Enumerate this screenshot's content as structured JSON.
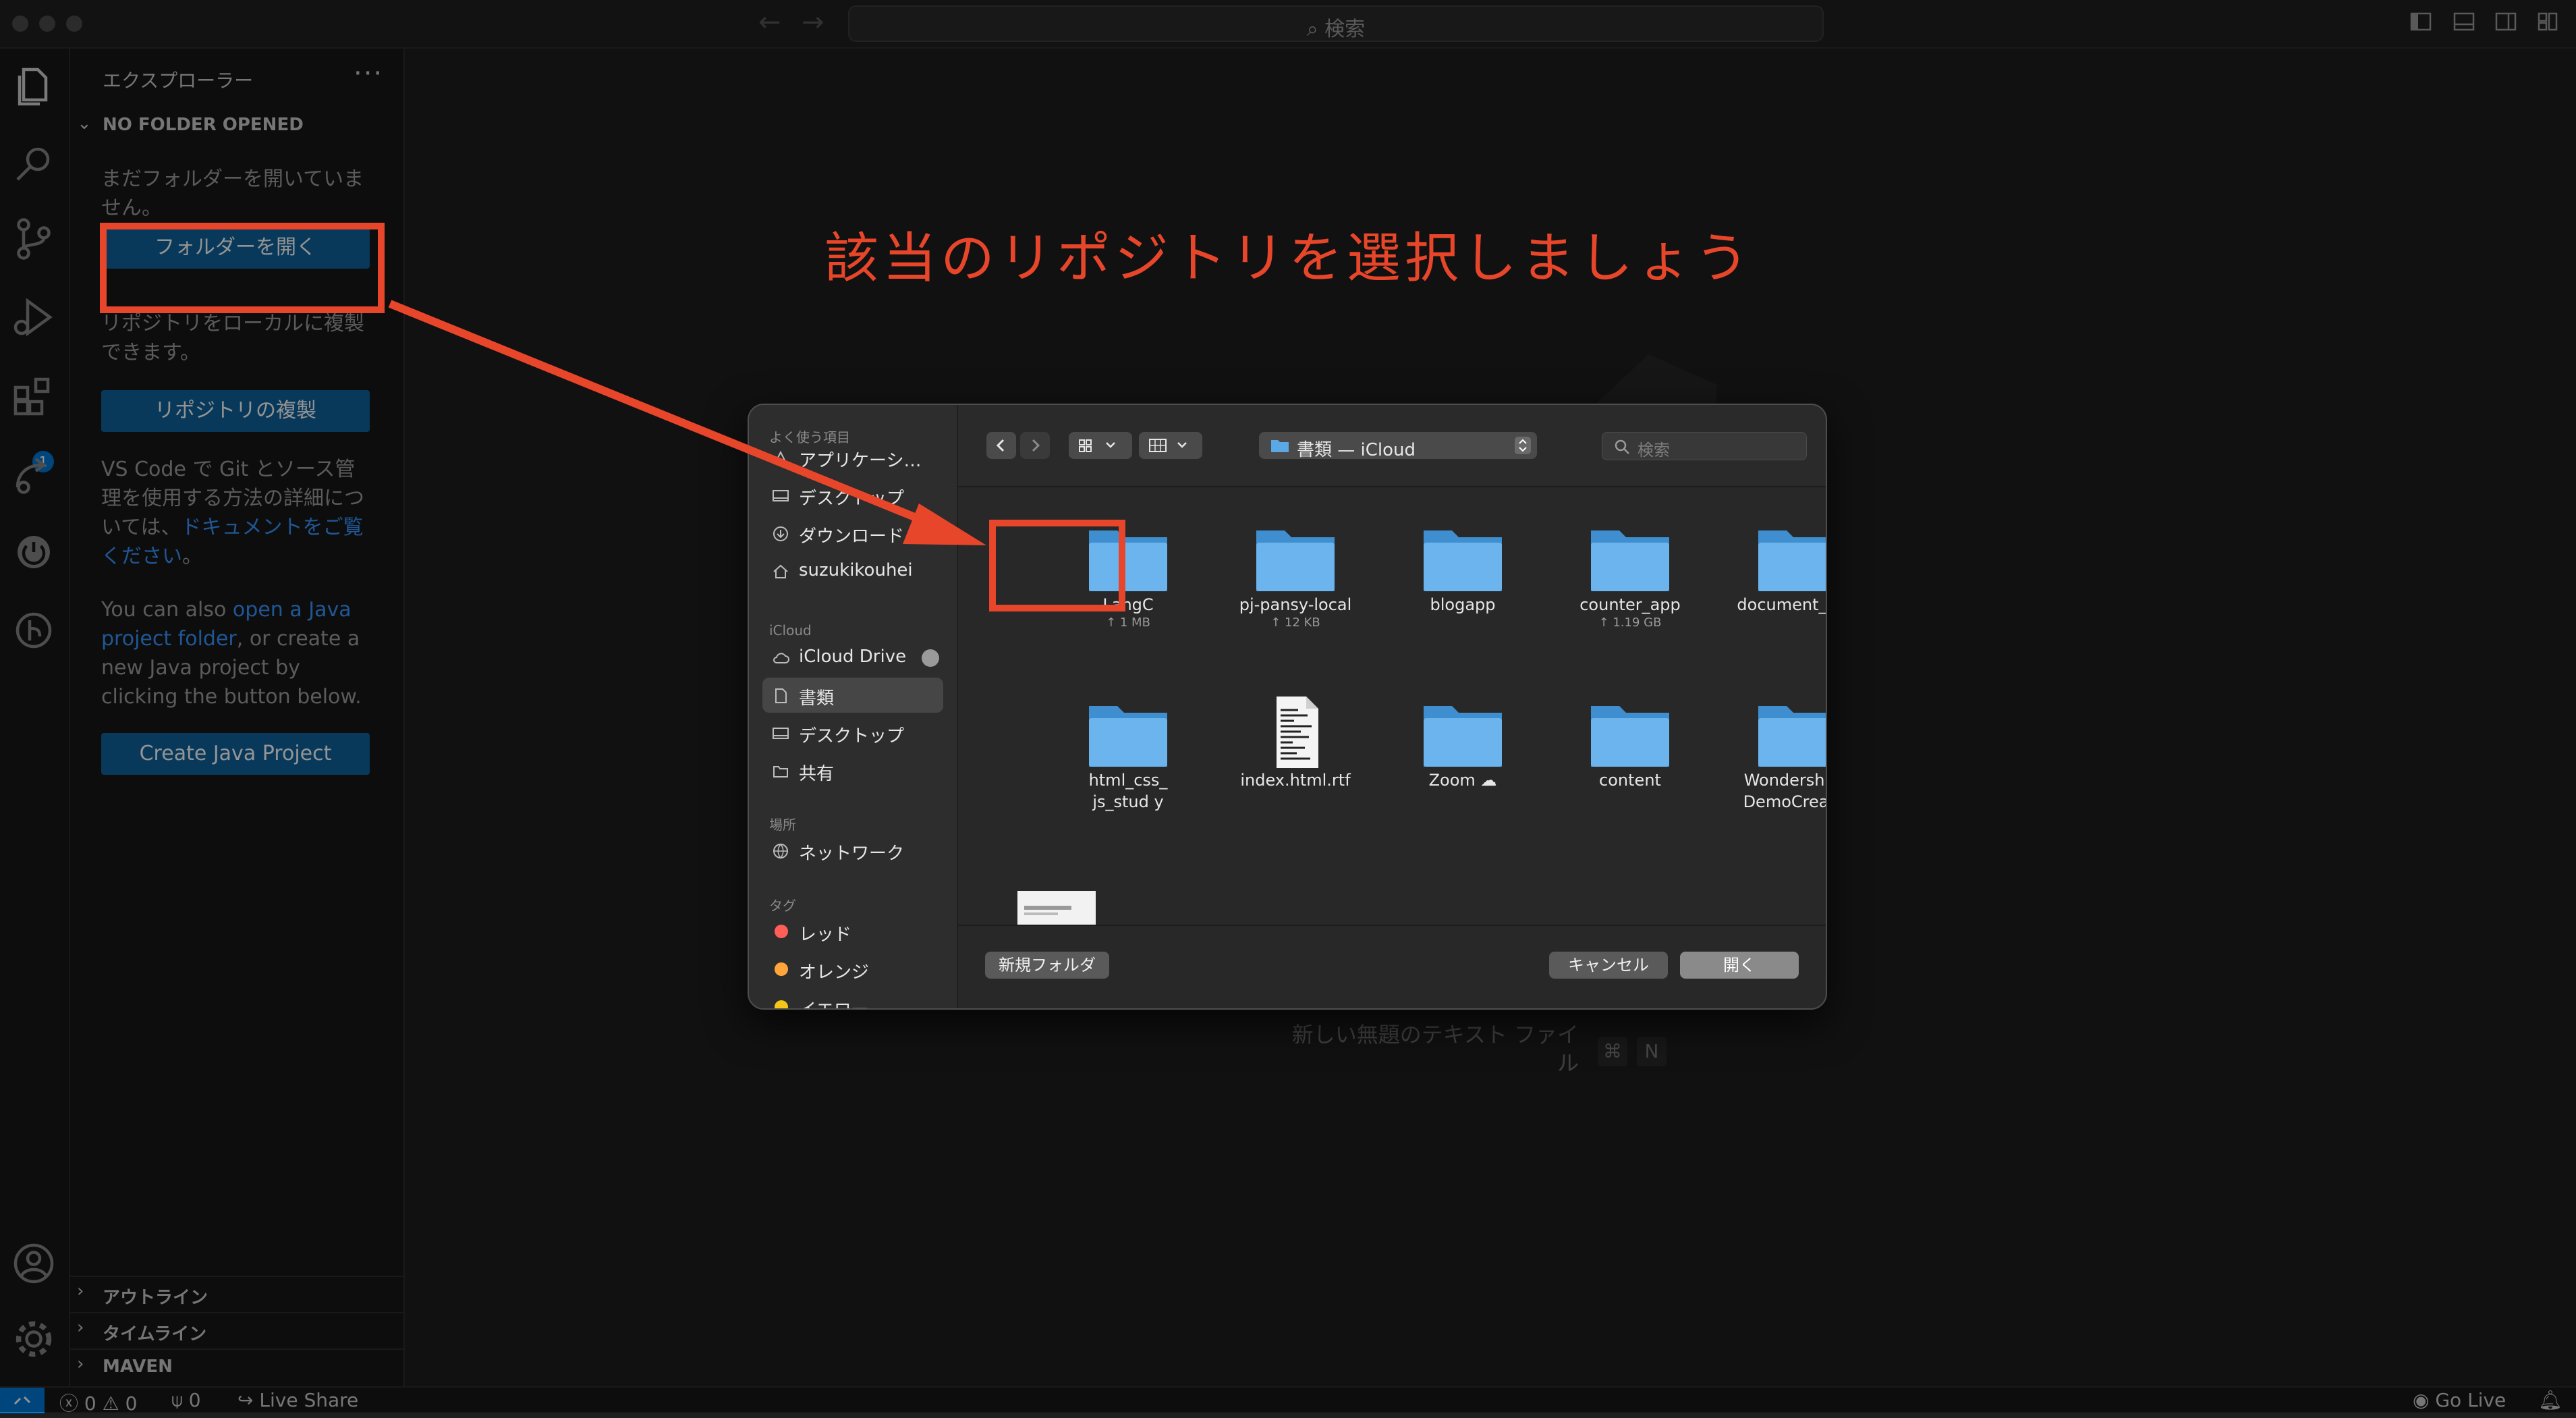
{
  "titlebar": {
    "search_label": "検索"
  },
  "sidebar": {
    "title": "エクスプローラー",
    "section_title": "NO FOLDER OPENED",
    "no_folder_text": "まだフォルダーを開いていません。",
    "open_folder_button": "フォルダーを開く",
    "clone_text": "リポジトリをローカルに複製できます。",
    "clone_button": "リポジトリの複製",
    "git_text_1": "VS Code で Git とソース管理を使用する方法の詳細については、",
    "git_link": "ドキュメントをご覧ください",
    "git_text_2": "。",
    "java_text_1": "You can also ",
    "java_link": "open a Java project folder",
    "java_text_2": ", or create a new Java project by clicking the button below.",
    "java_button": "Create Java Project",
    "bottom_sections": [
      "アウトライン",
      "タイムライン",
      "MAVEN"
    ],
    "badge_count": "1"
  },
  "annotation": {
    "text": "該当のリポジトリを選択しましょう",
    "color": "#e8462a"
  },
  "editor_hint": {
    "text": "新しい無題のテキスト ファイル",
    "keys": [
      "⌘",
      "N"
    ]
  },
  "dialog": {
    "sidebar": {
      "favorites_label": "よく使う項目",
      "favorites": [
        {
          "label": "アプリケーシ…",
          "icon": "applications-icon"
        },
        {
          "label": "デスクトップ",
          "icon": "desktop-icon"
        },
        {
          "label": "ダウンロード",
          "icon": "download-icon"
        },
        {
          "label": "suzukikouhei",
          "icon": "home-icon"
        }
      ],
      "icloud_label": "iCloud",
      "icloud": [
        {
          "label": "iCloud Drive",
          "icon": "cloud-icon"
        },
        {
          "label": "書類",
          "icon": "document-icon"
        },
        {
          "label": "デスクトップ",
          "icon": "desktop-icon"
        },
        {
          "label": "共有",
          "icon": "shared-folder-icon"
        }
      ],
      "locations_label": "場所",
      "locations": [
        {
          "label": "ネットワーク",
          "icon": "network-icon"
        }
      ],
      "tags_label": "タグ",
      "tags": [
        {
          "label": "レッド",
          "color": "#ff5f57"
        },
        {
          "label": "オレンジ",
          "color": "#ffa53b"
        },
        {
          "label": "イエロー",
          "color": "#f5c518"
        }
      ]
    },
    "path": "書類 — iCloud",
    "search_placeholder": "検索",
    "files": [
      {
        "name": "LangC",
        "sub": "↑ 1 MB",
        "type": "folder"
      },
      {
        "name": "pj-pansy-local",
        "sub": "↑ 12 KB",
        "type": "folder"
      },
      {
        "name": "blogapp",
        "sub": "",
        "type": "folder"
      },
      {
        "name": "counter_app",
        "sub": "↑ 1.19 GB",
        "type": "folder"
      },
      {
        "name": "document_test",
        "sub": "",
        "type": "folder"
      },
      {
        "name": "html_css_js_stud y",
        "sub": "",
        "type": "folder"
      },
      {
        "name": "index.html.rtf",
        "sub": "",
        "type": "document"
      },
      {
        "name": "Zoom ☁",
        "sub": "",
        "type": "folder"
      },
      {
        "name": "content",
        "sub": "",
        "type": "folder"
      },
      {
        "name": "Wondershare DemoCreator",
        "sub": "",
        "type": "folder"
      }
    ],
    "new_folder_button": "新規フォルダ",
    "cancel_button": "キャンセル",
    "open_button": "開く"
  },
  "statusbar": {
    "errors": "0",
    "warnings": "0",
    "ports": "0",
    "live_share": "Live Share",
    "go_live": "Go Live"
  }
}
